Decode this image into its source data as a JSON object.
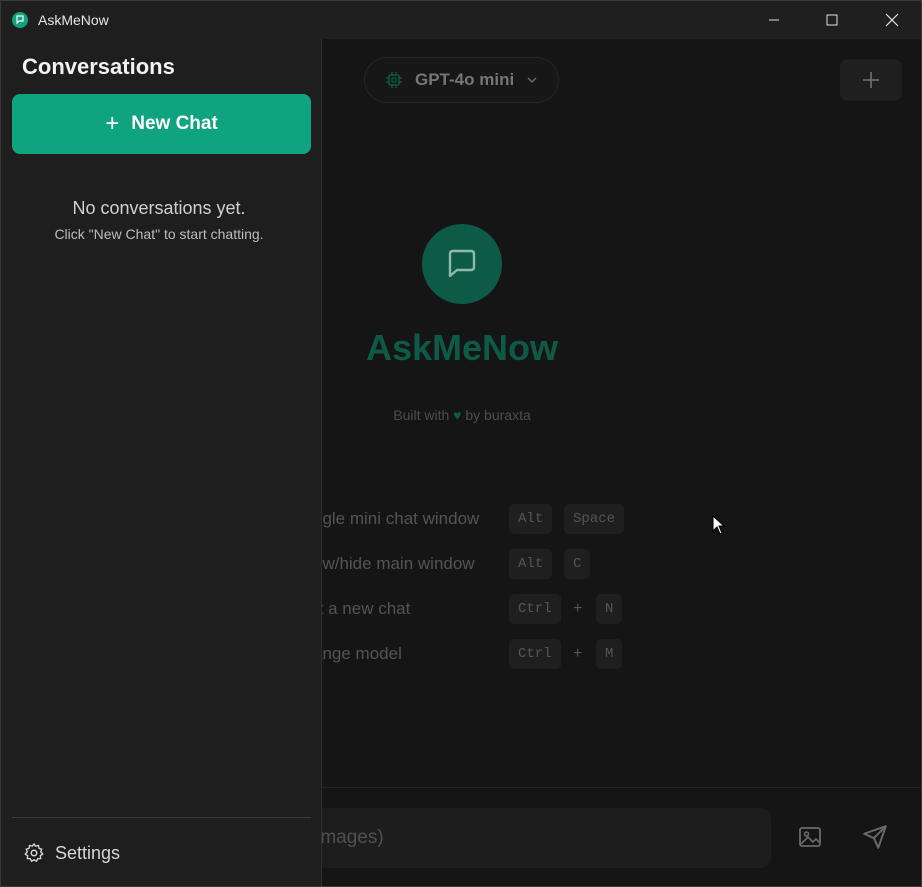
{
  "window": {
    "title": "AskMeNow"
  },
  "sidebar": {
    "title": "Conversations",
    "new_chat_label": "New Chat",
    "empty_title": "No conversations yet.",
    "empty_subtitle": "Click \"New Chat\" to start chatting.",
    "settings_label": "Settings"
  },
  "main": {
    "model_name": "GPT-4o mini",
    "brand": "AskMeNow",
    "built_prefix": "Built with",
    "built_heart": "♥",
    "built_suffix": "by buraxta",
    "shortcuts": [
      {
        "label": "ggle mini chat window",
        "keys": [
          "Alt",
          "Space"
        ],
        "separator": ""
      },
      {
        "label": "ow/hide main window",
        "keys": [
          "Alt",
          "C"
        ],
        "separator": ""
      },
      {
        "label": "rt a new chat",
        "keys": [
          "Ctrl",
          "N"
        ],
        "separator": "+"
      },
      {
        "label": "ange model",
        "keys": [
          "Ctrl",
          "M"
        ],
        "separator": "+"
      }
    ],
    "input_placeholder": "te images)"
  },
  "colors": {
    "accent": "#10a37f",
    "accent_dim": "#0d5b47",
    "background": "#151515",
    "sidebar": "#1e1e1e"
  },
  "icons": {
    "app": "chat-bubble-icon",
    "minimize": "minimize-icon",
    "maximize": "maximize-icon",
    "close": "close-icon",
    "model": "chip-icon",
    "model_dropdown": "chevron-down-icon",
    "new_top": "plus-icon",
    "logo": "message-square-icon",
    "image": "image-icon",
    "send": "send-icon",
    "settings": "gear-icon"
  }
}
